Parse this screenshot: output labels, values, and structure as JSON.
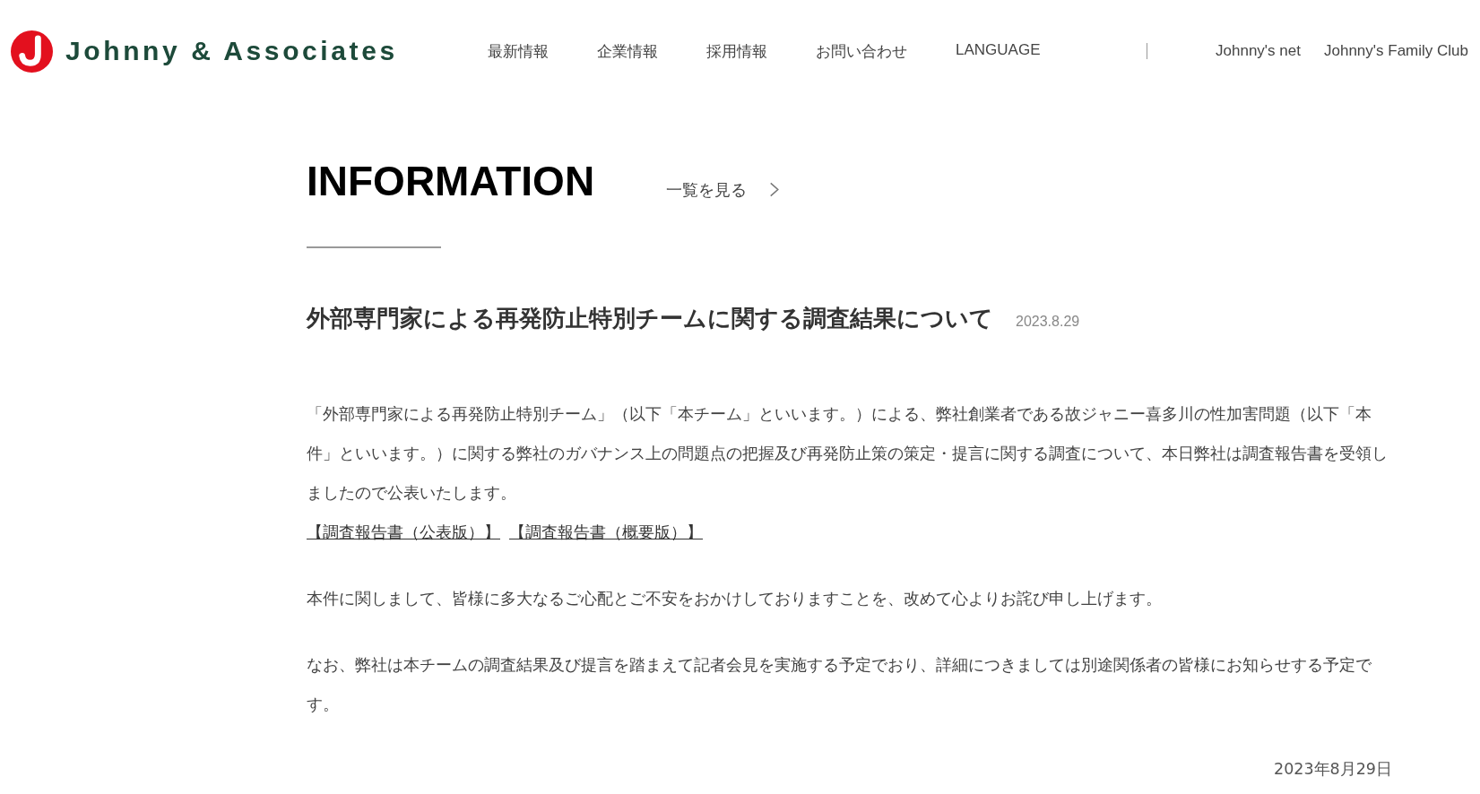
{
  "header": {
    "logo": {
      "text": "Johnny & Associates"
    },
    "nav": [
      {
        "label": "最新情報"
      },
      {
        "label": "企業情報"
      },
      {
        "label": "採用情報"
      },
      {
        "label": "お問い合わせ"
      },
      {
        "label": "LANGUAGE"
      }
    ],
    "external_links": [
      {
        "label": "Johnny's net"
      },
      {
        "label": "Johnny's Family Club"
      }
    ]
  },
  "section": {
    "title": "INFORMATION",
    "view_all": "一覧を見る"
  },
  "article": {
    "title": "外部専門家による再発防止特別チームに関する調査結果について",
    "date": "2023.8.29",
    "body": [
      {
        "kind": "paragraph",
        "text": "「外部専門家による再発防止特別チーム」（以下「本チーム」といいます。）による、弊社創業者である故ジャニー喜多川の性加害問題（以下「本件」といいます。）に関する弊社のガバナンス上の問題点の把握及び再発防止策の策定・提言に関する調査について、本日弊社は調査報告書を受領しましたので公表いたします。"
      },
      {
        "kind": "links",
        "links": [
          {
            "label": "【調査報告書（公表版）】"
          },
          {
            "label": "【調査報告書（概要版）】"
          }
        ]
      },
      {
        "kind": "paragraph",
        "text": "本件に関しまして、皆様に多大なるご心配とご不安をおかけしておりますことを、改めて心よりお詫び申し上げます。"
      },
      {
        "kind": "paragraph",
        "text": "なお、弊社は本チームの調査結果及び提言を踏まえて記者会見を実施する予定でおり、詳細につきましては別途関係者の皆様にお知らせする予定です。"
      }
    ],
    "signed_date": "2023年8月29日"
  }
}
